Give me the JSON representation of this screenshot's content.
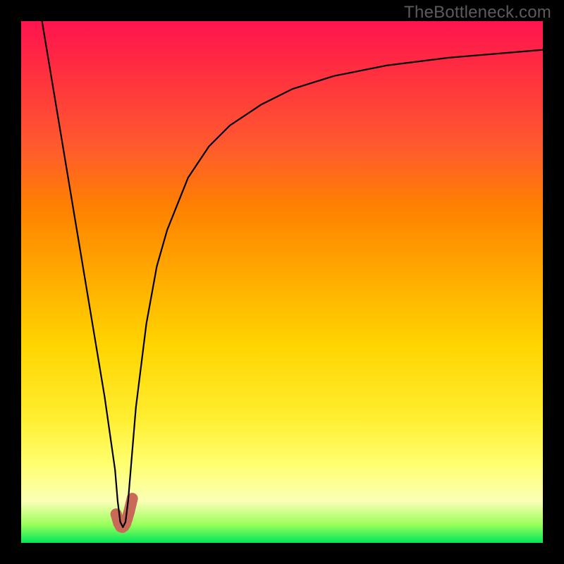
{
  "watermark": "TheBottleneck.com",
  "chart_data": {
    "type": "line",
    "title": "",
    "xlabel": "",
    "ylabel": "",
    "xlim": [
      0,
      100
    ],
    "ylim": [
      0,
      100
    ],
    "grid": false,
    "legend": false,
    "series": [
      {
        "name": "curve",
        "x": [
          4,
          6,
          8,
          10,
          12,
          14,
          16,
          18,
          18.5,
          19,
          19.5,
          20,
          20.5,
          21,
          22,
          24,
          26,
          28,
          32,
          36,
          40,
          46,
          52,
          60,
          70,
          82,
          94,
          100
        ],
        "y": [
          100,
          88,
          76,
          64,
          52,
          40,
          28,
          14,
          8,
          4,
          3,
          4,
          8,
          14,
          26,
          42,
          53,
          60,
          70,
          76,
          80,
          84,
          87,
          89.5,
          91.5,
          93,
          94,
          94.5
        ]
      },
      {
        "name": "glow-points",
        "x": [
          18.2,
          18.7,
          19.1,
          19.4,
          19.7,
          20.0,
          20.3,
          20.7,
          21.3
        ],
        "y": [
          5.5,
          3.8,
          3.1,
          3.0,
          3.2,
          3.7,
          4.6,
          6.0,
          8.5
        ]
      }
    ],
    "colors": {
      "curve_stroke": "#000000",
      "glow_stroke": "#c96a58",
      "gradient_top": "#ff1450",
      "gradient_bottom": "#00e65a"
    }
  }
}
